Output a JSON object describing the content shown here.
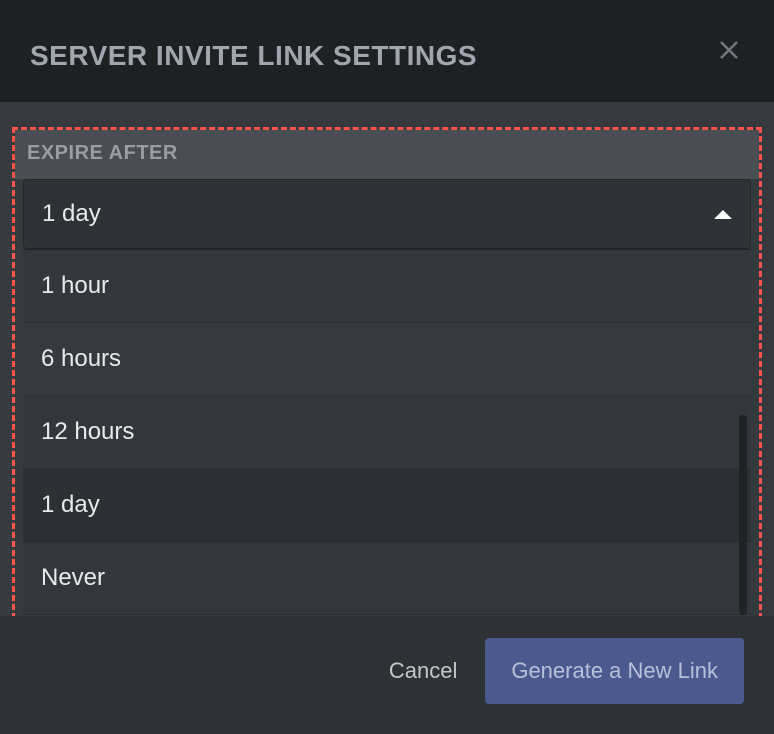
{
  "modal": {
    "title": "SERVER INVITE LINK SETTINGS"
  },
  "expire_section": {
    "label": "EXPIRE AFTER",
    "selected": "1 day",
    "options": [
      "1 hour",
      "6 hours",
      "12 hours",
      "1 day",
      "Never"
    ]
  },
  "footer": {
    "cancel_label": "Cancel",
    "generate_label": "Generate a New Link"
  }
}
